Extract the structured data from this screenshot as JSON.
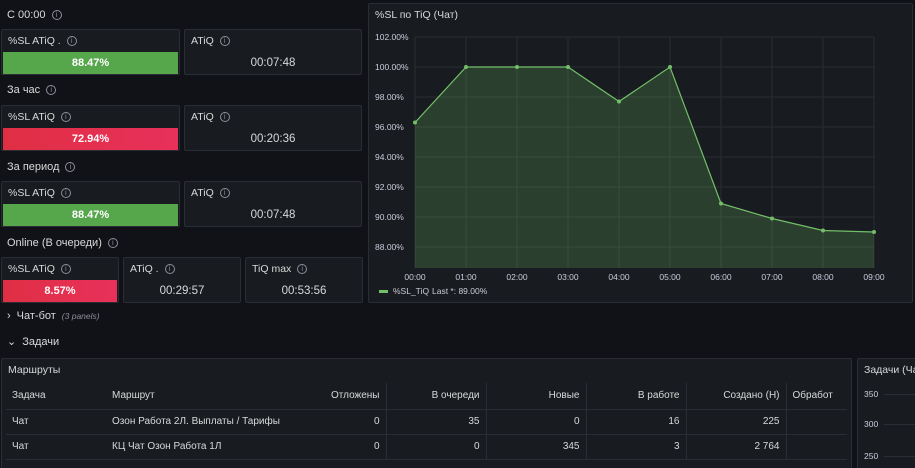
{
  "rows": {
    "c0000": "С 00:00",
    "hour": "За час",
    "period": "За период",
    "online": "Online (В очереди)"
  },
  "stats": {
    "row1": {
      "sl_title": "%SL ATiQ .",
      "sl_value": "88.47%",
      "atiq_title": "ATiQ",
      "atiq_value": "00:07:48"
    },
    "row2": {
      "sl_title": "%SL ATiQ",
      "sl_value": "72.94%",
      "atiq_title": "ATiQ",
      "atiq_value": "00:20:36"
    },
    "row3": {
      "sl_title": "%SL ATiQ",
      "sl_value": "88.47%",
      "atiq_title": "ATiQ",
      "atiq_value": "00:07:48"
    },
    "row4": {
      "sl_title": "%SL ATiQ",
      "sl_value": "8.57%",
      "atiq_title": "ATiQ .",
      "atiq_value": "00:29:57",
      "tiq_title": "TiQ max",
      "tiq_value": "00:53:56"
    }
  },
  "colors": {
    "green": "#56a64b",
    "red": "#e02f44",
    "line": "#73bf69"
  },
  "chart_panel": {
    "title": "%SL по TiQ (Чат)"
  },
  "chart_data": {
    "type": "area",
    "x": [
      "00:00",
      "01:00",
      "02:00",
      "03:00",
      "04:00",
      "05:00",
      "06:00",
      "07:00",
      "08:00",
      "09:00"
    ],
    "series": [
      {
        "name": "%SL_TiQ",
        "values": [
          96.3,
          100.0,
          100.0,
          100.0,
          97.7,
          100.0,
          90.9,
          89.9,
          89.1,
          89.0
        ]
      }
    ],
    "y_ticks": [
      "102.00%",
      "100.00%",
      "98.00%",
      "96.00%",
      "94.00%",
      "92.00%",
      "90.00%",
      "88.00%"
    ],
    "ylim": [
      86.6,
      102.0
    ],
    "legend_text": "%SL_TiQ",
    "legend_last": "Last *: 89.00%",
    "legend_position": "bottom-left",
    "grid": true
  },
  "sections": {
    "chatbot": {
      "label": "Чат-бот",
      "sub": "(3 panels)"
    },
    "tasks": {
      "label": "Задачи"
    }
  },
  "routes": {
    "title": "Маршруты",
    "columns": [
      "Задача",
      "Маршрут",
      "Отложены",
      "В очереди",
      "Новые",
      "В работе",
      "Создано (Н)",
      "Обработ"
    ],
    "rows": [
      [
        "Чат",
        "Озон Работа 2Л. Выплаты / Тарифы",
        "0",
        "35",
        "0",
        "16",
        "225",
        ""
      ],
      [
        "Чат",
        "КЦ Чат Озон Работа 1Л",
        "0",
        "0",
        "345",
        "3",
        "2 764",
        ""
      ]
    ]
  },
  "tasks_chart": {
    "title": "Задачи (Ча",
    "y_ticks": [
      "350",
      "300",
      "250"
    ]
  }
}
